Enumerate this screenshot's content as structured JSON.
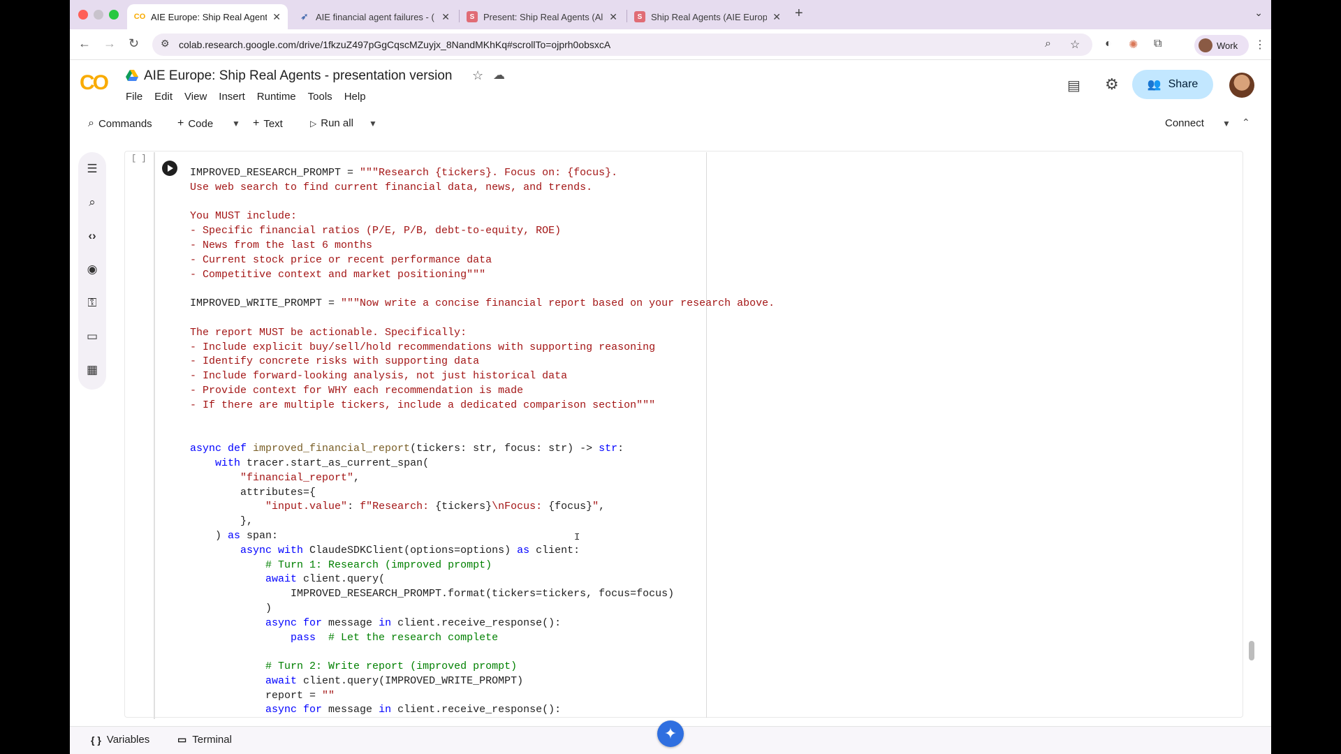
{
  "browser": {
    "tabs": [
      {
        "label": "AIE Europe: Ship Real Agents",
        "favicon": "colab-icon"
      },
      {
        "label": "AIE financial agent failures - (",
        "favicon": "bird-icon"
      },
      {
        "label": "Present: Ship Real Agents (Al",
        "favicon": "slides-icon"
      },
      {
        "label": "Ship Real Agents (AIE Europe",
        "favicon": "slides-icon"
      }
    ],
    "url": "colab.research.google.com/drive/1fkzuZ497pGgCqscMZuyjx_8NandMKhKq#scrollTo=ojprh0obsxcA",
    "profile_label": "Work"
  },
  "colab": {
    "logo": "CO",
    "title": "AIE Europe: Ship Real Agents - presentation version",
    "menu": [
      "File",
      "Edit",
      "View",
      "Insert",
      "Runtime",
      "Tools",
      "Help"
    ],
    "share_label": "Share",
    "toolbar": {
      "commands": "Commands",
      "code": "Code",
      "text": "Text",
      "run_all": "Run all",
      "connect": "Connect"
    },
    "cell_bracket": "[ ]",
    "status": {
      "variables": "Variables",
      "terminal": "Terminal"
    }
  },
  "code_lines": [
    [
      {
        "t": "IMPROVED_RESEARCH_PROMPT = ",
        "c": ""
      },
      {
        "t": "\"\"\"Research {tickers}. Focus on: {focus}.",
        "c": "str"
      }
    ],
    [
      {
        "t": "Use web search to find current financial data, news, and trends.",
        "c": "str"
      }
    ],
    [
      {
        "t": "",
        "c": ""
      }
    ],
    [
      {
        "t": "You MUST include:",
        "c": "str"
      }
    ],
    [
      {
        "t": "- Specific financial ratios (P/E, P/B, debt-to-equity, ROE)",
        "c": "str"
      }
    ],
    [
      {
        "t": "- News from the last 6 months",
        "c": "str"
      }
    ],
    [
      {
        "t": "- Current stock price or recent performance data",
        "c": "str"
      }
    ],
    [
      {
        "t": "- Competitive context and market positioning\"\"\"",
        "c": "str"
      }
    ],
    [
      {
        "t": "",
        "c": ""
      }
    ],
    [
      {
        "t": "IMPROVED_WRITE_PROMPT = ",
        "c": ""
      },
      {
        "t": "\"\"\"Now write a concise financial report based on your research above.",
        "c": "str"
      }
    ],
    [
      {
        "t": "",
        "c": ""
      }
    ],
    [
      {
        "t": "The report MUST be actionable. Specifically:",
        "c": "str"
      }
    ],
    [
      {
        "t": "- Include explicit buy/sell/hold recommendations with supporting reasoning",
        "c": "str"
      }
    ],
    [
      {
        "t": "- Identify concrete risks with supporting data",
        "c": "str"
      }
    ],
    [
      {
        "t": "- Include forward-looking analysis, not just historical data",
        "c": "str"
      }
    ],
    [
      {
        "t": "- Provide context for WHY each recommendation is made",
        "c": "str"
      }
    ],
    [
      {
        "t": "- If there are multiple tickers, include a dedicated comparison section\"\"\"",
        "c": "str"
      }
    ],
    [
      {
        "t": "",
        "c": ""
      }
    ],
    [
      {
        "t": "",
        "c": ""
      }
    ],
    [
      {
        "t": "async def ",
        "c": "kw"
      },
      {
        "t": "improved_financial_report",
        "c": "fn"
      },
      {
        "t": "(tickers: str, focus: str) -> ",
        "c": ""
      },
      {
        "t": "str",
        "c": "kw"
      },
      {
        "t": ":",
        "c": ""
      }
    ],
    [
      {
        "t": "    ",
        "c": ""
      },
      {
        "t": "with ",
        "c": "kw"
      },
      {
        "t": "tracer.start_as_current_span(",
        "c": ""
      }
    ],
    [
      {
        "t": "        ",
        "c": ""
      },
      {
        "t": "\"financial_report\"",
        "c": "str"
      },
      {
        "t": ",",
        "c": ""
      }
    ],
    [
      {
        "t": "        attributes={",
        "c": ""
      }
    ],
    [
      {
        "t": "            ",
        "c": ""
      },
      {
        "t": "\"input.value\"",
        "c": "str"
      },
      {
        "t": ": ",
        "c": ""
      },
      {
        "t": "f\"Research: ",
        "c": "str"
      },
      {
        "t": "{tickers}",
        "c": ""
      },
      {
        "t": "\\nFocus: ",
        "c": "str"
      },
      {
        "t": "{focus}",
        "c": ""
      },
      {
        "t": "\"",
        "c": "str"
      },
      {
        "t": ",",
        "c": ""
      }
    ],
    [
      {
        "t": "        },",
        "c": ""
      }
    ],
    [
      {
        "t": "    ) ",
        "c": ""
      },
      {
        "t": "as ",
        "c": "kw"
      },
      {
        "t": "span:",
        "c": ""
      }
    ],
    [
      {
        "t": "        ",
        "c": ""
      },
      {
        "t": "async with ",
        "c": "kw"
      },
      {
        "t": "ClaudeSDKClient(options=options) ",
        "c": ""
      },
      {
        "t": "as ",
        "c": "kw"
      },
      {
        "t": "client:",
        "c": ""
      }
    ],
    [
      {
        "t": "            ",
        "c": ""
      },
      {
        "t": "# Turn 1: Research (improved prompt)",
        "c": "cm"
      }
    ],
    [
      {
        "t": "            ",
        "c": ""
      },
      {
        "t": "await ",
        "c": "kw"
      },
      {
        "t": "client.query(",
        "c": ""
      }
    ],
    [
      {
        "t": "                IMPROVED_RESEARCH_PROMPT.format(tickers=tickers, focus=focus)",
        "c": ""
      }
    ],
    [
      {
        "t": "            )",
        "c": ""
      }
    ],
    [
      {
        "t": "            ",
        "c": ""
      },
      {
        "t": "async for ",
        "c": "kw"
      },
      {
        "t": "message ",
        "c": ""
      },
      {
        "t": "in ",
        "c": "kw"
      },
      {
        "t": "client.receive_response():",
        "c": ""
      }
    ],
    [
      {
        "t": "                ",
        "c": ""
      },
      {
        "t": "pass  ",
        "c": "kw"
      },
      {
        "t": "# Let the research complete",
        "c": "cm"
      }
    ],
    [
      {
        "t": "",
        "c": ""
      }
    ],
    [
      {
        "t": "            ",
        "c": ""
      },
      {
        "t": "# Turn 2: Write report (improved prompt)",
        "c": "cm"
      }
    ],
    [
      {
        "t": "            ",
        "c": ""
      },
      {
        "t": "await ",
        "c": "kw"
      },
      {
        "t": "client.query(IMPROVED_WRITE_PROMPT)",
        "c": ""
      }
    ],
    [
      {
        "t": "            report = ",
        "c": ""
      },
      {
        "t": "\"\"",
        "c": "str"
      }
    ],
    [
      {
        "t": "            ",
        "c": ""
      },
      {
        "t": "async for ",
        "c": "kw"
      },
      {
        "t": "message ",
        "c": ""
      },
      {
        "t": "in ",
        "c": "kw"
      },
      {
        "t": "client.receive_response():",
        "c": ""
      }
    ]
  ]
}
